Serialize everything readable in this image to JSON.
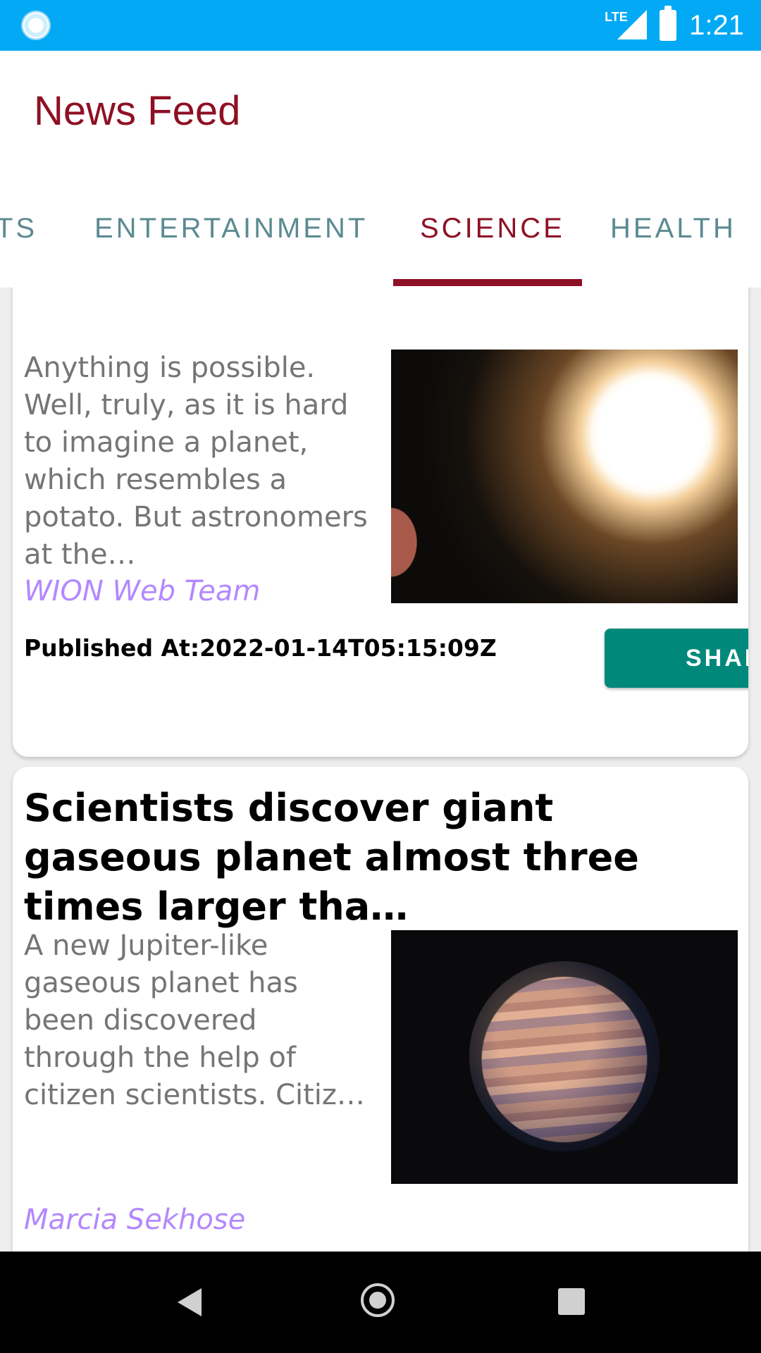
{
  "status_bar": {
    "network_label": "LTE",
    "time": "1:21"
  },
  "app_bar": {
    "title": "News Feed"
  },
  "tabs": [
    {
      "label": "TS",
      "active": false
    },
    {
      "label": "ENTERTAINMENT",
      "active": false
    },
    {
      "label": "SCIENCE",
      "active": true
    },
    {
      "label": "HEALTH",
      "active": false
    }
  ],
  "articles": [
    {
      "description": "Anything is possible. Well, truly, as it is hard to imagine a planet, which resembles a potato. But astronomers at the…",
      "image": "star-and-planet-image",
      "author": "WION Web Team",
      "published": "Published At:2022-01-14T05:15:09Z",
      "share_label": "SHARE"
    },
    {
      "title": "Scientists discover giant gaseous planet almost three times larger tha…",
      "description": "A new Jupiter-like gaseous planet has been discovered through the help of citizen scientists. Citiz…",
      "image": "gas-giant-planet-image",
      "author": "Marcia Sekhose"
    }
  ],
  "colors": {
    "status_bar": "#03A9F4",
    "brand": "#8E1024",
    "tab_inactive": "#5b8a92",
    "author": "#b388ff",
    "share_button": "#00897B"
  },
  "nav_bar": {
    "icons": [
      "back-icon",
      "home-icon",
      "recents-icon"
    ]
  }
}
